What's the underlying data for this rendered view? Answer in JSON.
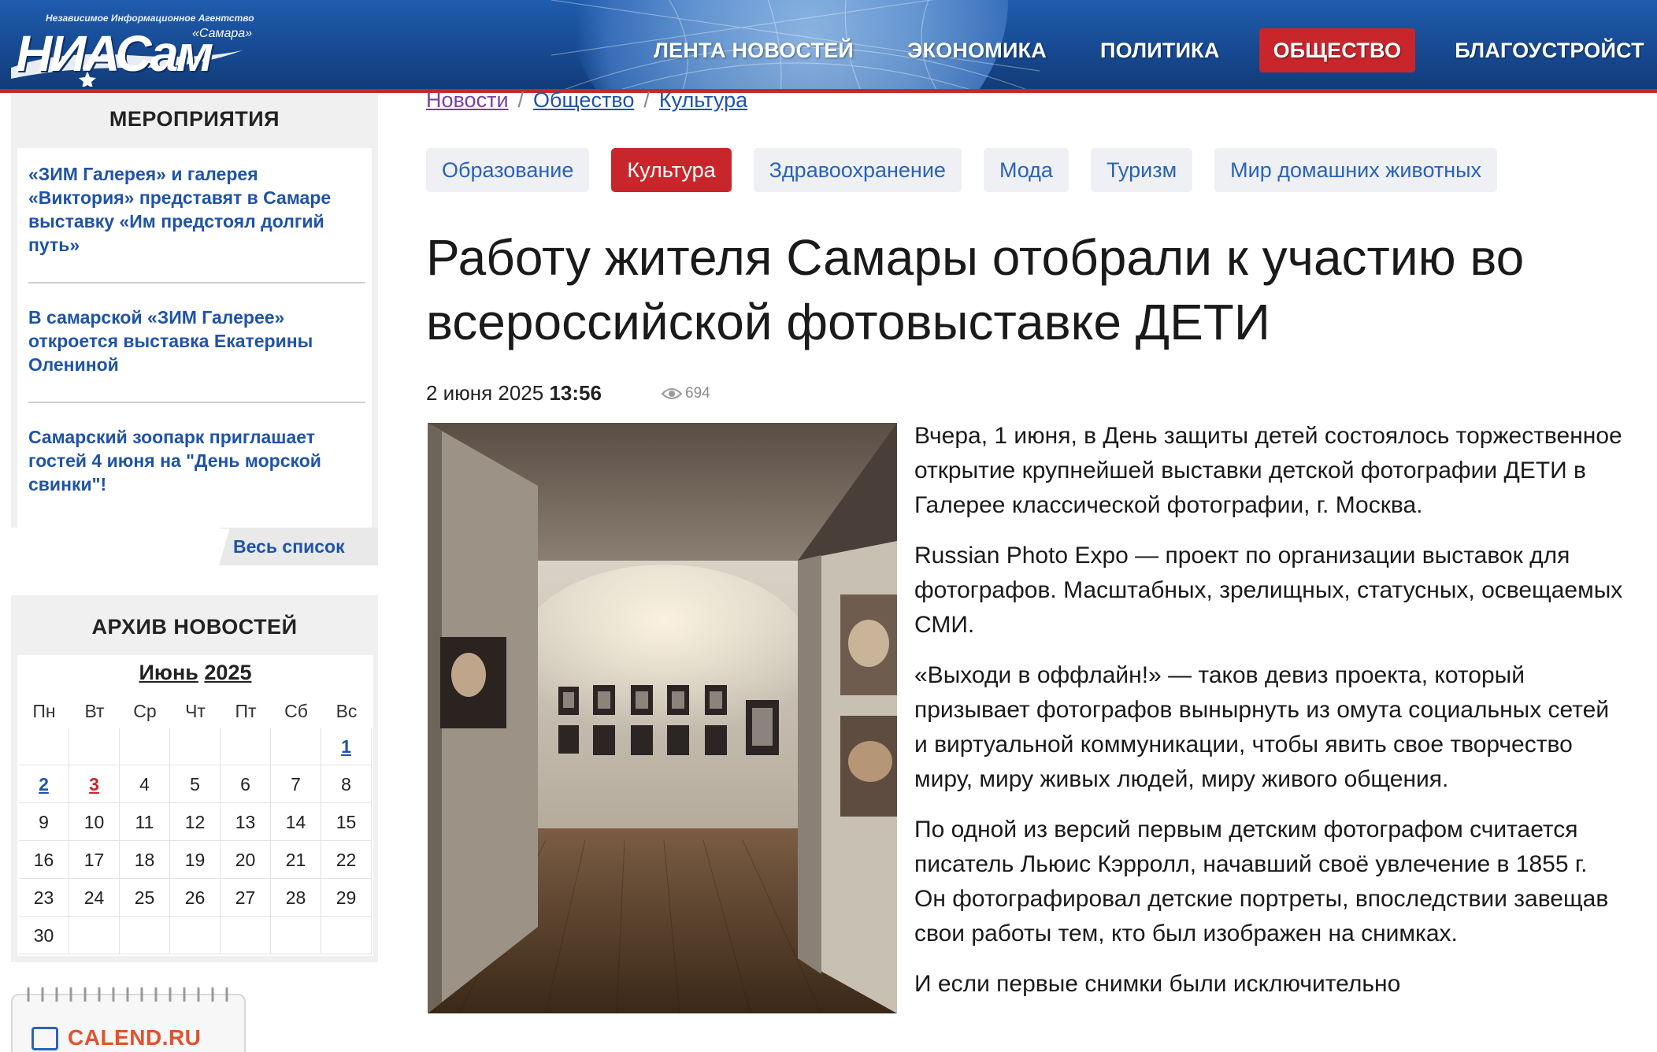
{
  "header": {
    "agency_tagline": "Независимое Информационное Агентство",
    "logo_wordmark": "НИАСам",
    "logo_city": "«Самара»",
    "nav": [
      {
        "label": "ЛЕНТА НОВОСТЕЙ",
        "active": false
      },
      {
        "label": "ЭКОНОМИКА",
        "active": false
      },
      {
        "label": "ПОЛИТИКА",
        "active": false
      },
      {
        "label": "ОБЩЕСТВО",
        "active": true
      },
      {
        "label": "БЛАГОУСТРОЙСТ",
        "active": false
      }
    ]
  },
  "sidebar": {
    "events_title": "МЕРОПРИЯТИЯ",
    "events": [
      "«ЗИМ Галерея» и галерея «Виктория» представят в Самаре выставку «Им предстоял долгий путь»",
      "В самарской «ЗИМ Галерее» откроется выставка Екатерины Олениной",
      "Самарский зоопарк приглашает гостей 4 июня на \"День морской свинки\"!"
    ],
    "all_list": "Весь список",
    "archive_title": "АРХИВ НОВОСТЕЙ",
    "calendar": {
      "month": "Июнь",
      "year": "2025",
      "weekdays": [
        "Пн",
        "Вт",
        "Ср",
        "Чт",
        "Пт",
        "Сб",
        "Вс"
      ],
      "weeks": [
        [
          "",
          "",
          "",
          "",
          "",
          "",
          "1"
        ],
        [
          "2",
          "3",
          "4",
          "5",
          "6",
          "7",
          "8"
        ],
        [
          "9",
          "10",
          "11",
          "12",
          "13",
          "14",
          "15"
        ],
        [
          "16",
          "17",
          "18",
          "19",
          "20",
          "21",
          "22"
        ],
        [
          "23",
          "24",
          "25",
          "26",
          "27",
          "28",
          "29"
        ],
        [
          "30",
          "",
          "",
          "",
          "",
          "",
          ""
        ]
      ],
      "linked_days": [
        "1",
        "2"
      ],
      "today": "3"
    },
    "calend_label": "CALEND.RU"
  },
  "breadcrumb": [
    "Новости",
    "Общество",
    "Культура"
  ],
  "tags": [
    {
      "label": "Образование",
      "active": false
    },
    {
      "label": "Культура",
      "active": true
    },
    {
      "label": "Здравоохранение",
      "active": false
    },
    {
      "label": "Мода",
      "active": false
    },
    {
      "label": "Туризм",
      "active": false
    },
    {
      "label": "Мир домашних животных",
      "active": false
    }
  ],
  "article": {
    "title": "Работу жителя Самары отобрали к участию во всероссийской фотовыставке ДЕТИ",
    "date": "2 июня 2025",
    "time": "13:56",
    "views": "694",
    "paragraphs": [
      "Вчера, 1 июня, в День защиты детей состоялось торжественное открытие крупнейшей выставки детской фотографии ДЕТИ в Галерее классической фотографии, г. Москва.",
      "Russian Photo Expo — проект по организации выставок для фотографов. Масштабных, зрелищных, статусных, освещаемых СМИ.",
      "«Выходи в оффлайн!» — таков девиз проекта, который призывает фотографов вынырнуть из омута социальных сетей и виртуальной коммуникации, чтобы явить свое творчество миру, миру живых людей, миру живого общения.",
      "По одной из версий первым детским фотографом считается писатель Льюис Кэрролл, начавший своё увлечение в 1855 г.  Он фотографировал детские портреты, впоследствии завещав свои работы тем, кто был изображен на снимках.",
      "И если первые снимки были исключительно"
    ]
  },
  "colors": {
    "header_blue": "#1f5cae",
    "accent_red": "#c8262b",
    "link_blue": "#1f53a8"
  }
}
